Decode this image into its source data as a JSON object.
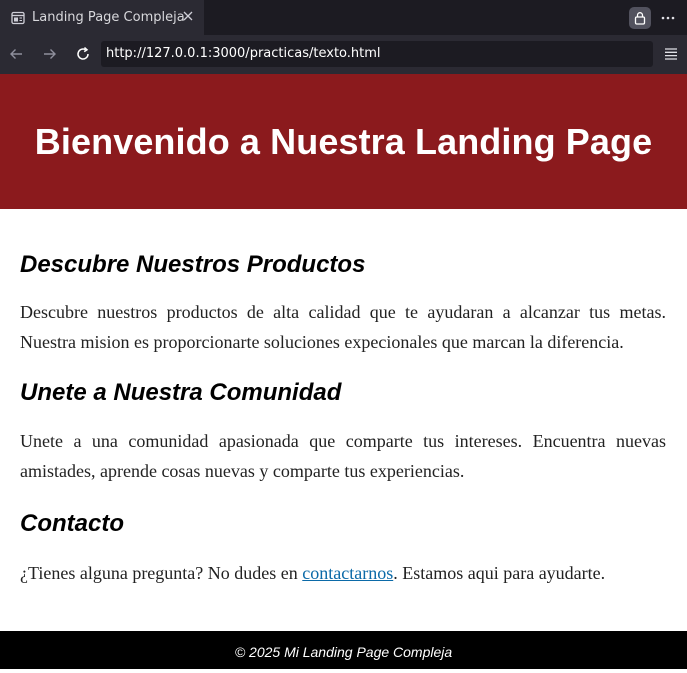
{
  "browser": {
    "tab_title": "Landing Page Compleja",
    "url": "http://127.0.0.1:3000/practicas/texto.html",
    "icons": [
      "page-icon",
      "close-icon",
      "lock-icon",
      "more-icon",
      "back-icon",
      "forward-icon",
      "reload-icon",
      "menu-icon"
    ]
  },
  "hero": {
    "title": "Bienvenido a Nuestra Landing Page",
    "background_color": "#8b1a1d"
  },
  "sections": [
    {
      "heading": "Descubre Nuestros Productos",
      "text": "Descubre nuestros productos de alta calidad que te ayudaran a alcanzar tus metas. Nuestra mision es proporcionarte soluciones expecionales que marcan la diferencia."
    },
    {
      "heading": "Unete a Nuestra Comunidad",
      "text": "Unete a una comunidad apasionada que comparte tus intereses. Encuentra nuevas amistades, aprende cosas nuevas y comparte tus experiencias."
    },
    {
      "heading": "Contacto",
      "text_before": "¿Tienes alguna pregunta? No dudes en ",
      "link": "contactarnos",
      "text_after": ". Estamos aqui para ayudarte."
    }
  ],
  "footer": {
    "text": "© 2025 Mi Landing Page Compleja",
    "background_color": "#000000"
  }
}
